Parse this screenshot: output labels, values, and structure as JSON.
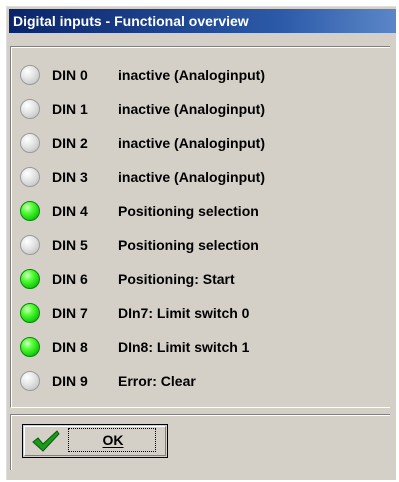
{
  "window": {
    "title": "Digital inputs - Functional overview"
  },
  "colors": {
    "title_bar": "#0a246a",
    "led_active": "#18d010",
    "led_inactive": "#d0d0d0",
    "face": "#d4d0c8"
  },
  "inputs": [
    {
      "name": "DIN 0",
      "function": "inactive (Analoginput)",
      "active": false
    },
    {
      "name": "DIN 1",
      "function": "inactive (Analoginput)",
      "active": false
    },
    {
      "name": "DIN 2",
      "function": "inactive (Analoginput)",
      "active": false
    },
    {
      "name": "DIN 3",
      "function": "inactive (Analoginput)",
      "active": false
    },
    {
      "name": "DIN 4",
      "function": "Positioning selection",
      "active": true
    },
    {
      "name": "DIN 5",
      "function": "Positioning selection",
      "active": false
    },
    {
      "name": "DIN 6",
      "function": "Positioning: Start",
      "active": true
    },
    {
      "name": "DIN 7",
      "function": "DIn7: Limit switch 0",
      "active": true
    },
    {
      "name": "DIN 8",
      "function": "DIn8: Limit switch 1",
      "active": true
    },
    {
      "name": "DIN 9",
      "function": "Error: Clear",
      "active": false
    }
  ],
  "ok_button": {
    "label": "OK",
    "icon": "checkmark-icon"
  }
}
